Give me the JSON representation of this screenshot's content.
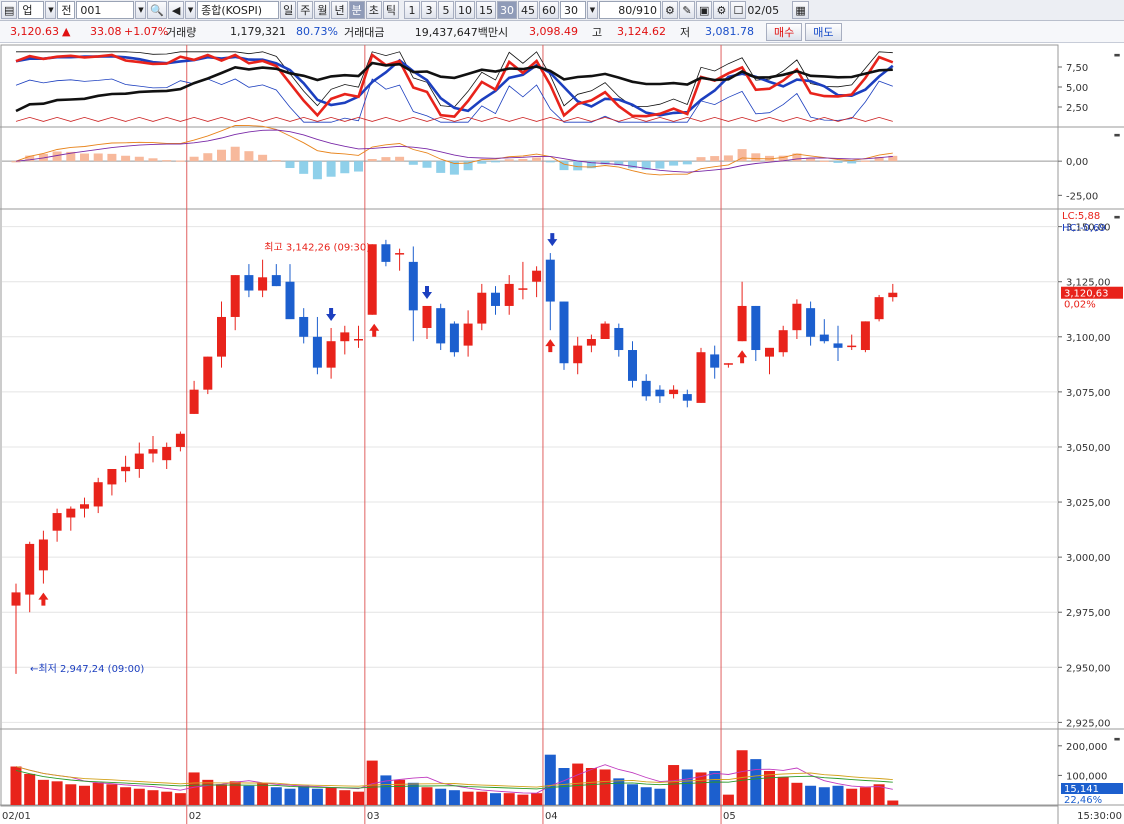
{
  "toolbar": {
    "market_type": "업",
    "code_type": "전",
    "code": "001",
    "index_name": "종합(KOSPI)",
    "period_tabs": [
      "일",
      "주",
      "월",
      "년",
      "분",
      "초",
      "틱"
    ],
    "active_period": "분",
    "intervals": [
      "1",
      "3",
      "5",
      "10",
      "15",
      "30",
      "45",
      "60"
    ],
    "active_interval": "30",
    "interval_value": "30",
    "bar_count": "80/910",
    "date": "02/05"
  },
  "quote": {
    "price": "3,120.63",
    "change": "33.08",
    "change_pct": "+1.07%",
    "volume_label": "거래량",
    "volume": "1,179,321",
    "volume_ratio": "80.73%",
    "amount_label": "거래대금",
    "amount": "19,437,647백만",
    "open_label": "시",
    "open": "3,098.49",
    "high_label": "고",
    "high": "3,124.62",
    "low_label": "저",
    "low": "3,081.78",
    "buy_label": "매수",
    "sell_label": "매도"
  },
  "chart_data": {
    "type": "candlestick",
    "indicator1": {
      "ticks": [
        "7,50",
        "5,00",
        "2,50"
      ],
      "ylim": [
        0,
        10
      ]
    },
    "indicator2": {
      "ticks": [
        "0,00",
        "-25,00"
      ],
      "ylim": [
        -35,
        25
      ]
    },
    "price": {
      "ticks": [
        "3,150,00",
        "3,125,00",
        "3,100,00",
        "3,075,00",
        "3,050,00",
        "3,025,00",
        "3,000,00",
        "2,975,00",
        "2,950,00",
        "2,925,00"
      ],
      "ylim": [
        2922,
        3158
      ],
      "lc_label": "LC:5,88",
      "hc_label": "HC:-0,69",
      "last_price_label": "3,120,63",
      "last_pct_label": "0,02%",
      "high_annotation": "최고 3,142,26 (09:30)",
      "low_annotation": "←최저 2,947,24 (09:00)"
    },
    "volume": {
      "ticks": [
        "200,000",
        "100,000"
      ],
      "ylim": [
        0,
        250000
      ],
      "last_label": "15,141",
      "pct_label": "22,46%"
    },
    "x_labels": [
      {
        "i": 0,
        "label": "02/01"
      },
      {
        "i": 13,
        "label": "02"
      },
      {
        "i": 26,
        "label": "03"
      },
      {
        "i": 39,
        "label": "04"
      },
      {
        "i": 52,
        "label": "05"
      }
    ],
    "time_label": "15:30:00",
    "candles": [
      {
        "o": 2978,
        "h": 2988,
        "l": 2947,
        "c": 2984,
        "v": 130000
      },
      {
        "o": 2983,
        "h": 3007,
        "l": 2975,
        "c": 3006,
        "v": 105000
      },
      {
        "o": 2994,
        "h": 3012,
        "l": 2988,
        "c": 3008,
        "v": 85000
      },
      {
        "o": 3012,
        "h": 3022,
        "l": 3007,
        "c": 3020,
        "v": 80000
      },
      {
        "o": 3018,
        "h": 3023,
        "l": 3012,
        "c": 3022,
        "v": 70000
      },
      {
        "o": 3022,
        "h": 3027,
        "l": 3018,
        "c": 3024,
        "v": 65000
      },
      {
        "o": 3023,
        "h": 3036,
        "l": 3020,
        "c": 3034,
        "v": 75000
      },
      {
        "o": 3033,
        "h": 3040,
        "l": 3028,
        "c": 3040,
        "v": 70000
      },
      {
        "o": 3039,
        "h": 3046,
        "l": 3034,
        "c": 3041,
        "v": 60000
      },
      {
        "o": 3040,
        "h": 3052,
        "l": 3036,
        "c": 3047,
        "v": 55000
      },
      {
        "o": 3047,
        "h": 3055,
        "l": 3043,
        "c": 3049,
        "v": 50000
      },
      {
        "o": 3044,
        "h": 3052,
        "l": 3040,
        "c": 3050,
        "v": 45000
      },
      {
        "o": 3050,
        "h": 3057,
        "l": 3048,
        "c": 3056,
        "v": 40000
      },
      {
        "o": 3065,
        "h": 3080,
        "l": 3065,
        "c": 3076,
        "v": 110000
      },
      {
        "o": 3076,
        "h": 3091,
        "l": 3074,
        "c": 3091,
        "v": 85000
      },
      {
        "o": 3091,
        "h": 3116,
        "l": 3086,
        "c": 3109,
        "v": 70000
      },
      {
        "o": 3109,
        "h": 3128,
        "l": 3103,
        "c": 3128,
        "v": 80000
      },
      {
        "o": 3128,
        "h": 3133,
        "l": 3118,
        "c": 3121,
        "v": 65000
      },
      {
        "o": 3121,
        "h": 3135,
        "l": 3118,
        "c": 3127,
        "v": 75000
      },
      {
        "o": 3128,
        "h": 3133,
        "l": 3123,
        "c": 3123,
        "v": 60000
      },
      {
        "o": 3125,
        "h": 3133,
        "l": 3119,
        "c": 3108,
        "v": 55000
      },
      {
        "o": 3109,
        "h": 3113,
        "l": 3097,
        "c": 3100,
        "v": 65000
      },
      {
        "o": 3100,
        "h": 3109,
        "l": 3083,
        "c": 3086,
        "v": 55000
      },
      {
        "o": 3086,
        "h": 3104,
        "l": 3081,
        "c": 3098,
        "v": 60000
      },
      {
        "o": 3098,
        "h": 3105,
        "l": 3092,
        "c": 3102,
        "v": 50000
      },
      {
        "o": 3099,
        "h": 3105,
        "l": 3095,
        "c": 3099,
        "v": 45000
      },
      {
        "o": 3110,
        "h": 3142,
        "l": 3110,
        "c": 3142,
        "v": 150000
      },
      {
        "o": 3142,
        "h": 3144,
        "l": 3132,
        "c": 3134,
        "v": 100000
      },
      {
        "o": 3138,
        "h": 3140,
        "l": 3130,
        "c": 3138,
        "v": 85000
      },
      {
        "o": 3134,
        "h": 3141,
        "l": 3098,
        "c": 3112,
        "v": 75000
      },
      {
        "o": 3104,
        "h": 3114,
        "l": 3099,
        "c": 3114,
        "v": 60000
      },
      {
        "o": 3113,
        "h": 3115,
        "l": 3094,
        "c": 3097,
        "v": 55000
      },
      {
        "o": 3106,
        "h": 3107,
        "l": 3091,
        "c": 3093,
        "v": 50000
      },
      {
        "o": 3096,
        "h": 3112,
        "l": 3091,
        "c": 3106,
        "v": 45000
      },
      {
        "o": 3106,
        "h": 3124,
        "l": 3103,
        "c": 3120,
        "v": 45000
      },
      {
        "o": 3120,
        "h": 3123,
        "l": 3110,
        "c": 3114,
        "v": 40000
      },
      {
        "o": 3114,
        "h": 3128,
        "l": 3110,
        "c": 3124,
        "v": 40000
      },
      {
        "o": 3122,
        "h": 3134,
        "l": 3117,
        "c": 3122,
        "v": 35000
      },
      {
        "o": 3125,
        "h": 3132,
        "l": 3118,
        "c": 3130,
        "v": 40000
      },
      {
        "o": 3135,
        "h": 3138,
        "l": 3103,
        "c": 3116,
        "v": 170000
      },
      {
        "o": 3116,
        "h": 3116,
        "l": 3085,
        "c": 3088,
        "v": 125000
      },
      {
        "o": 3088,
        "h": 3100,
        "l": 3083,
        "c": 3096,
        "v": 140000
      },
      {
        "o": 3096,
        "h": 3101,
        "l": 3093,
        "c": 3099,
        "v": 125000
      },
      {
        "o": 3099,
        "h": 3107,
        "l": 3099,
        "c": 3106,
        "v": 120000
      },
      {
        "o": 3104,
        "h": 3106,
        "l": 3091,
        "c": 3094,
        "v": 90000
      },
      {
        "o": 3094,
        "h": 3098,
        "l": 3077,
        "c": 3080,
        "v": 70000
      },
      {
        "o": 3080,
        "h": 3083,
        "l": 3071,
        "c": 3073,
        "v": 60000
      },
      {
        "o": 3076,
        "h": 3078,
        "l": 3070,
        "c": 3073,
        "v": 55000
      },
      {
        "o": 3074,
        "h": 3078,
        "l": 3072,
        "c": 3076,
        "v": 135000
      },
      {
        "o": 3074,
        "h": 3076,
        "l": 3068,
        "c": 3071,
        "v": 120000
      },
      {
        "o": 3070,
        "h": 3095,
        "l": 3070,
        "c": 3093,
        "v": 110000
      },
      {
        "o": 3092,
        "h": 3096,
        "l": 3081,
        "c": 3086,
        "v": 115000
      },
      {
        "o": 3088,
        "h": 3088,
        "l": 3086,
        "c": 3088,
        "v": 35000
      },
      {
        "o": 3098,
        "h": 3125,
        "l": 3098,
        "c": 3114,
        "v": 185000
      },
      {
        "o": 3114,
        "h": 3114,
        "l": 3089,
        "c": 3094,
        "v": 155000
      },
      {
        "o": 3091,
        "h": 3094,
        "l": 3083,
        "c": 3095,
        "v": 115000
      },
      {
        "o": 3093,
        "h": 3105,
        "l": 3091,
        "c": 3103,
        "v": 95000
      },
      {
        "o": 3103,
        "h": 3117,
        "l": 3099,
        "c": 3115,
        "v": 75000
      },
      {
        "o": 3113,
        "h": 3116,
        "l": 3096,
        "c": 3100,
        "v": 65000
      },
      {
        "o": 3101,
        "h": 3108,
        "l": 3097,
        "c": 3098,
        "v": 60000
      },
      {
        "o": 3097,
        "h": 3105,
        "l": 3089,
        "c": 3095,
        "v": 65000
      },
      {
        "o": 3096,
        "h": 3101,
        "l": 3094,
        "c": 3096,
        "v": 55000
      },
      {
        "o": 3094,
        "h": 3107,
        "l": 3093,
        "c": 3107,
        "v": 60000
      },
      {
        "o": 3108,
        "h": 3119,
        "l": 3107,
        "c": 3118,
        "v": 70000
      },
      {
        "o": 3118,
        "h": 3124,
        "l": 3116,
        "c": 3120,
        "v": 15141
      }
    ],
    "colors": {
      "up": "#e8231b",
      "down": "#1c5fce",
      "divider": "#e06060",
      "grid": "#e4e4e4"
    }
  }
}
